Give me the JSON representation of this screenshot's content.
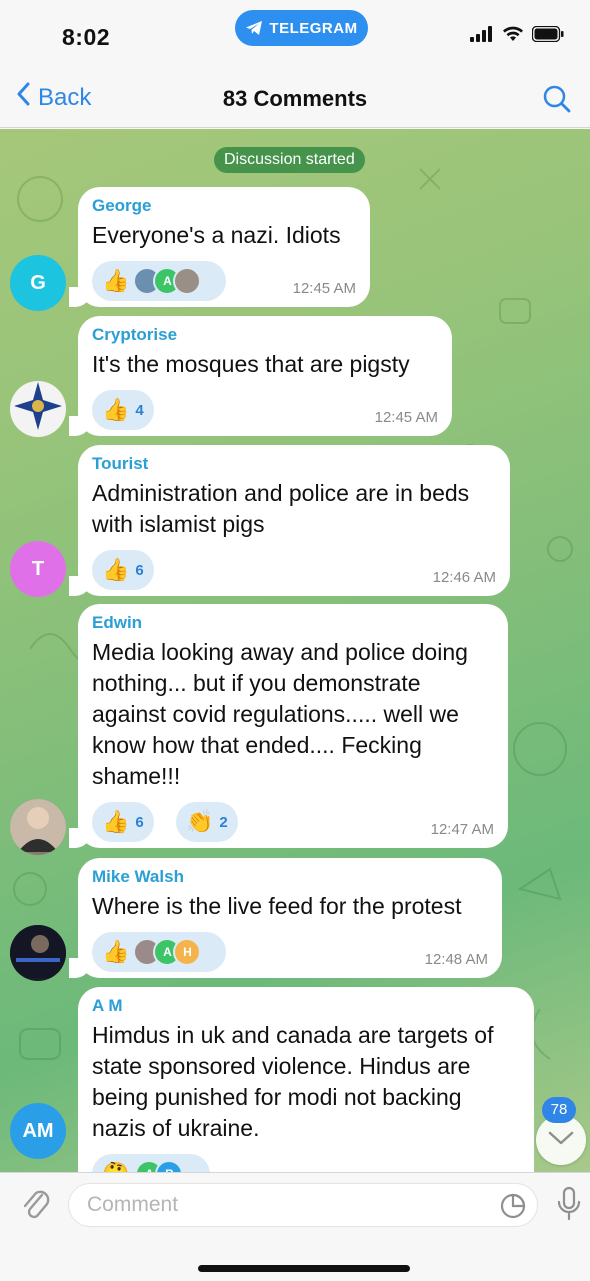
{
  "status_bar": {
    "time": "8:02",
    "app_pill": "TELEGRAM"
  },
  "nav": {
    "back_label": "Back",
    "title": "83 Comments"
  },
  "system_message": "Discussion started",
  "comments": [
    {
      "author": "George",
      "author_color": "#2a9fd6",
      "avatar_initial": "G",
      "avatar_color": "#1cc4e0",
      "text": "Everyone's a nazi. Idiots",
      "reaction_count": "",
      "reaction_avatars": [
        "",
        "A",
        ""
      ],
      "time": "12:45 AM"
    },
    {
      "author": "Cryptorise",
      "author_color": "#2a9fd6",
      "avatar_initial": "",
      "text": "It's the mosques that are pigsty",
      "reaction_count": "4",
      "time": "12:45 AM"
    },
    {
      "author": "Tourist",
      "author_color": "#2a9fd6",
      "avatar_initial": "T",
      "avatar_color": "#e070e8",
      "text": "Administration and police are in beds with islamist pigs",
      "reaction_count": "6",
      "time": "12:46 AM"
    },
    {
      "author": "Edwin",
      "author_color": "#2a9fd6",
      "avatar_initial": "",
      "text": "Media looking away and police doing nothing... but if you demonstrate against covid regulations..... well we know how that ended.... Fecking shame!!!",
      "reaction_count": "6",
      "second_reaction_count": "2",
      "time": "12:47 AM"
    },
    {
      "author": "Mike Walsh",
      "author_color": "#2a9fd6",
      "avatar_initial": "",
      "text": "Where is the live feed for the protest",
      "reaction_avatars": [
        "",
        "A",
        "H"
      ],
      "time": "12:48 AM"
    },
    {
      "author": "A M",
      "author_color": "#2a9fd6",
      "avatar_initial": "AM",
      "avatar_color": "#2a9fe8",
      "text": "Himdus in uk and canada are targets of state sponsored violence. Hindus are being punished for modi not backing nazis of ukraine.",
      "reaction_avatars": [
        "A",
        "B"
      ]
    }
  ],
  "unread_badge": "78",
  "input": {
    "placeholder": "Comment"
  },
  "colors": {
    "accent": "#2f86e6",
    "reaction_bg": "#daeaf7",
    "reaction_count": "#2d7fd6"
  }
}
